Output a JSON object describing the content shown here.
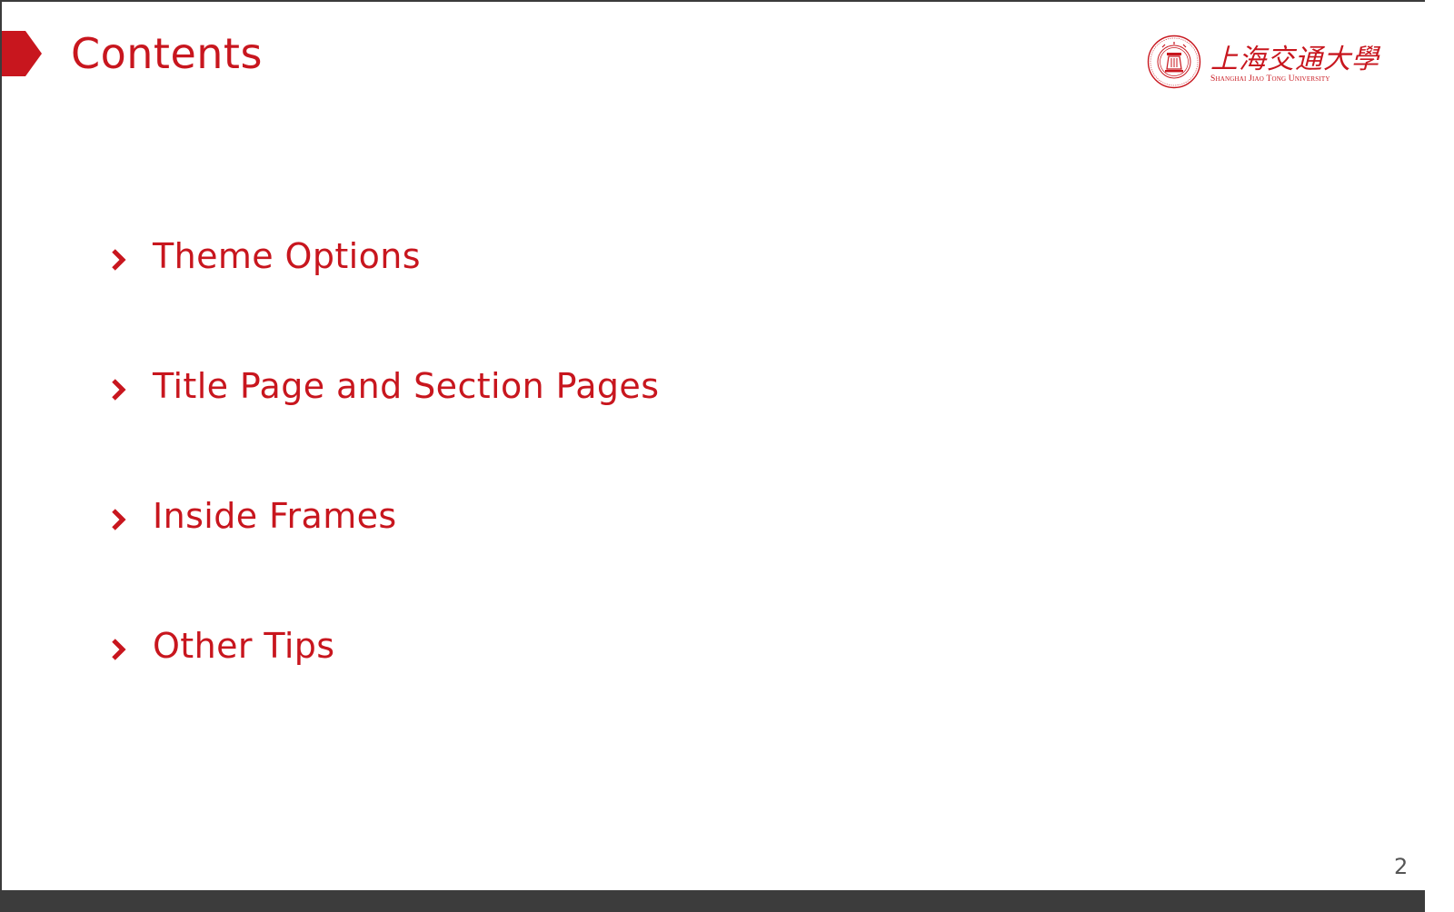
{
  "slide": {
    "title": "Contents",
    "accent_color": "#c8161e",
    "page_number": "2"
  },
  "logo": {
    "chinese_name": "上海交通大學",
    "english_name": "Shanghai Jiao Tong University",
    "emblem_icon": "university-seal-icon"
  },
  "toc": {
    "items": [
      {
        "label": "Theme Options",
        "icon": "chevron-right-icon"
      },
      {
        "label": "Title Page and Section Pages",
        "icon": "chevron-right-icon"
      },
      {
        "label": "Inside Frames",
        "icon": "chevron-right-icon"
      },
      {
        "label": "Other Tips",
        "icon": "chevron-right-icon"
      }
    ]
  }
}
